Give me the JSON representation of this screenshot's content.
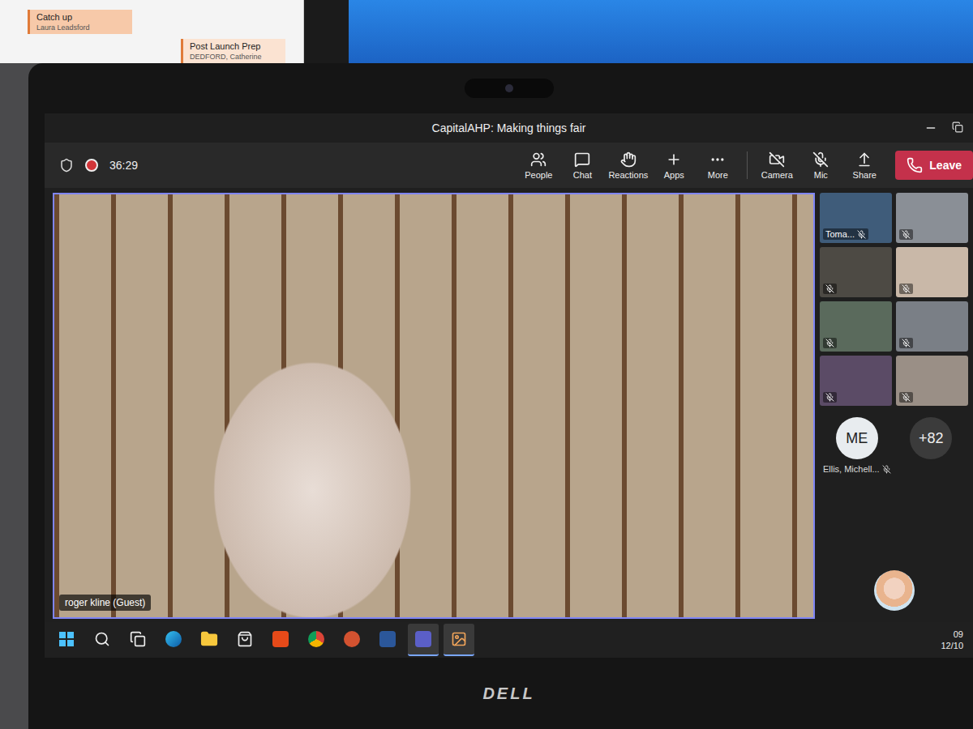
{
  "background_calendar": {
    "events": [
      {
        "title": "Catch up",
        "organizer": "Laura Leadsford"
      },
      {
        "title": "Post Launch Prep",
        "organizer": "DEDFORD, Catherine"
      }
    ]
  },
  "window": {
    "title": "CapitalAHP: Making things fair"
  },
  "meeting": {
    "timer": "36:29",
    "recording": true
  },
  "toolbar": [
    {
      "kind": "people",
      "label": "People"
    },
    {
      "kind": "chat",
      "label": "Chat"
    },
    {
      "kind": "reactions",
      "label": "Reactions"
    },
    {
      "kind": "apps",
      "label": "Apps"
    },
    {
      "kind": "more",
      "label": "More"
    },
    {
      "kind": "camera",
      "label": "Camera",
      "on": false
    },
    {
      "kind": "mic",
      "label": "Mic",
      "on": false
    },
    {
      "kind": "share",
      "label": "Share"
    },
    {
      "kind": "leave",
      "label": "Leave"
    }
  ],
  "stage": {
    "speaker": "roger kline (Guest)"
  },
  "participants": [
    {
      "name": "Toma...",
      "muted": true
    },
    {
      "name": "",
      "muted": true
    },
    {
      "name": "",
      "muted": true
    },
    {
      "name": "",
      "muted": true
    },
    {
      "name": "",
      "muted": true
    },
    {
      "name": "",
      "muted": true
    },
    {
      "name": "",
      "muted": true
    },
    {
      "name": "",
      "muted": true
    }
  ],
  "avatar": {
    "initials": "ME",
    "name": "Ellis, Michell...",
    "muted": true
  },
  "overflow": "+82",
  "taskbar": {
    "apps": [
      {
        "kind": "start",
        "active": false
      },
      {
        "kind": "search",
        "active": false
      },
      {
        "kind": "taskview",
        "active": false
      },
      {
        "kind": "edge",
        "active": false
      },
      {
        "kind": "explorer",
        "active": false
      },
      {
        "kind": "store",
        "active": false
      },
      {
        "kind": "office",
        "active": false
      },
      {
        "kind": "chrome",
        "active": false
      },
      {
        "kind": "powerpoint",
        "active": false
      },
      {
        "kind": "word",
        "active": false
      },
      {
        "kind": "teams",
        "active": true
      },
      {
        "kind": "photos",
        "active": true
      }
    ],
    "time": "09",
    "date": "12/10"
  },
  "laptop_brand": "DELL"
}
